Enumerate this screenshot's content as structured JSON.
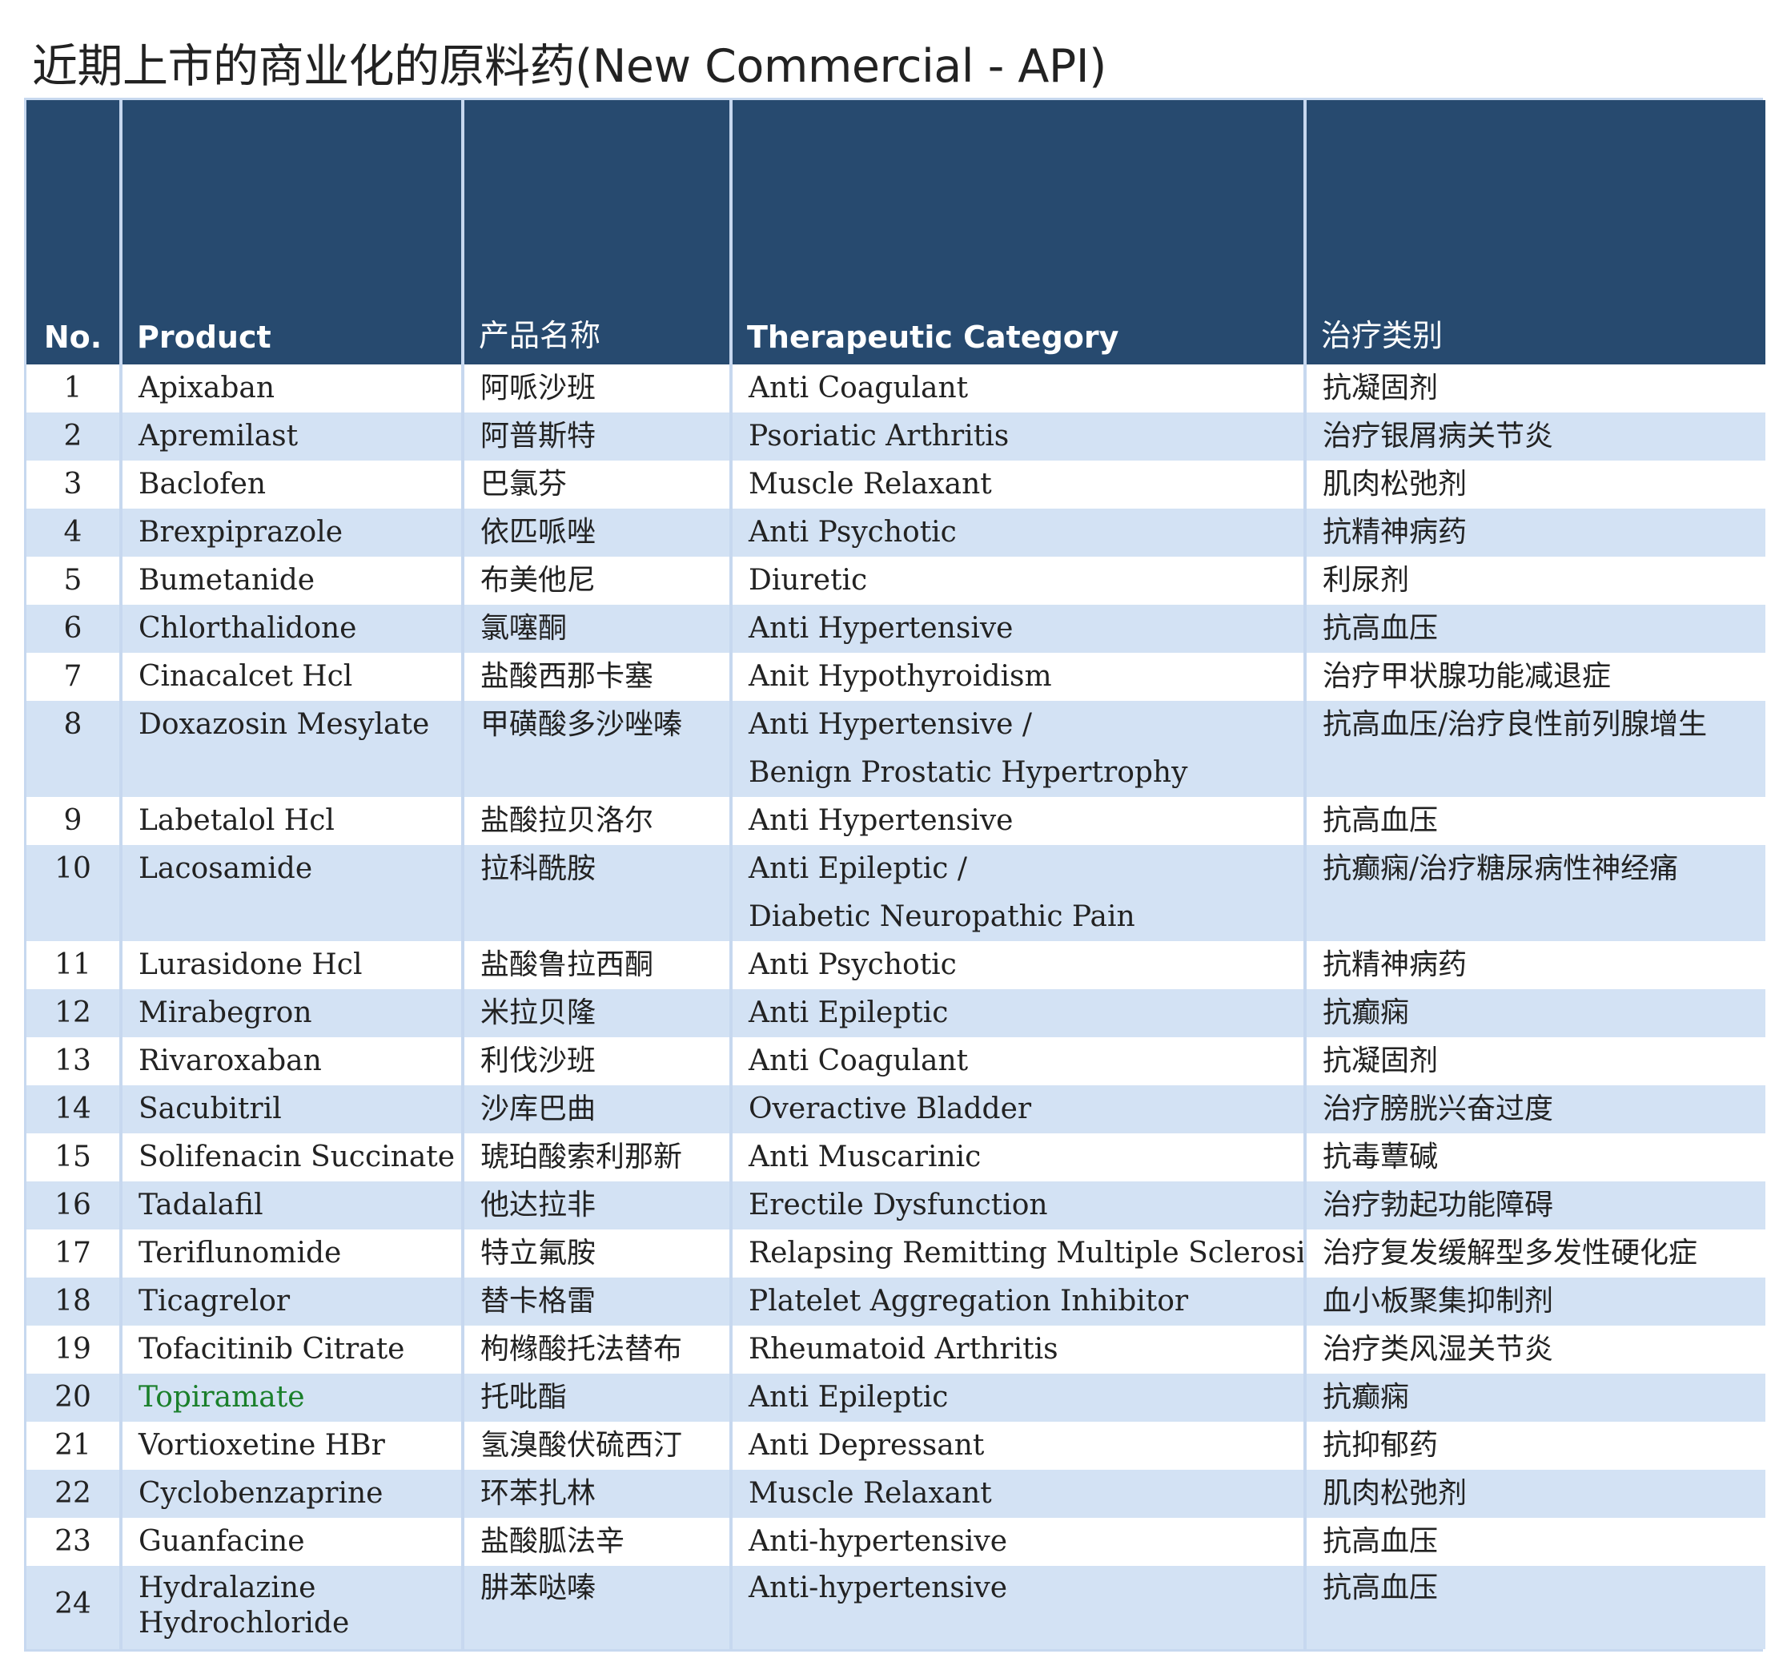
{
  "title": "近期上市的商业化的原料药(New Commercial - API)",
  "table": {
    "headers": {
      "no": "No.",
      "product": "Product",
      "product_cn": "产品名称",
      "category": "Therapeutic Category",
      "category_cn": "治疗类别"
    },
    "rows": [
      {
        "no": "1",
        "product": [
          "Apixaban"
        ],
        "product_cn": "阿哌沙班",
        "category": [
          "Anti Coagulant"
        ],
        "category_cn": "抗凝固剂"
      },
      {
        "no": "2",
        "product": [
          "Apremilast"
        ],
        "product_cn": "阿普斯特",
        "category": [
          "Psoriatic Arthritis"
        ],
        "category_cn": "治疗银屑病关节炎"
      },
      {
        "no": "3",
        "product": [
          "Baclofen"
        ],
        "product_cn": "巴氯芬",
        "category": [
          "Muscle Relaxant"
        ],
        "category_cn": "肌肉松弛剂"
      },
      {
        "no": "4",
        "product": [
          "Brexpiprazole"
        ],
        "product_cn": "依匹哌唑",
        "category": [
          "Anti Psychotic"
        ],
        "category_cn": "抗精神病药"
      },
      {
        "no": "5",
        "product": [
          "Bumetanide"
        ],
        "product_cn": "布美他尼",
        "category": [
          "Diuretic"
        ],
        "category_cn": "利尿剂"
      },
      {
        "no": "6",
        "product": [
          "Chlorthalidone"
        ],
        "product_cn": "氯噻酮",
        "category": [
          "Anti Hypertensive"
        ],
        "category_cn": "抗高血压"
      },
      {
        "no": "7",
        "product": [
          "Cinacalcet Hcl"
        ],
        "product_cn": "盐酸西那卡塞",
        "category": [
          "Anit Hypothyroidism"
        ],
        "category_cn": "治疗甲状腺功能减退症"
      },
      {
        "no": "8",
        "product": [
          "Doxazosin Mesylate"
        ],
        "product_cn": "甲磺酸多沙唑嗪",
        "category": [
          "Anti Hypertensive /",
          "Benign Prostatic Hypertrophy"
        ],
        "category_cn": "抗高血压/治疗良性前列腺增生"
      },
      {
        "no": "9",
        "product": [
          "Labetalol Hcl"
        ],
        "product_cn": "盐酸拉贝洛尔",
        "category": [
          "Anti Hypertensive"
        ],
        "category_cn": "抗高血压"
      },
      {
        "no": "10",
        "product": [
          "Lacosamide"
        ],
        "product_cn": "拉科酰胺",
        "category": [
          "Anti Epileptic /",
          "Diabetic Neuropathic Pain"
        ],
        "category_cn": "抗癫痫/治疗糖尿病性神经痛"
      },
      {
        "no": "11",
        "product": [
          "Lurasidone Hcl"
        ],
        "product_cn": "盐酸鲁拉西酮",
        "category": [
          "Anti Psychotic"
        ],
        "category_cn": "抗精神病药"
      },
      {
        "no": "12",
        "product": [
          "Mirabegron"
        ],
        "product_cn": "米拉贝隆",
        "category": [
          "Anti Epileptic"
        ],
        "category_cn": "抗癫痫"
      },
      {
        "no": "13",
        "product": [
          "Rivaroxaban"
        ],
        "product_cn": "利伐沙班",
        "category": [
          "Anti Coagulant"
        ],
        "category_cn": "抗凝固剂"
      },
      {
        "no": "14",
        "product": [
          "Sacubitril"
        ],
        "product_cn": "沙库巴曲",
        "category": [
          "Overactive Bladder"
        ],
        "category_cn": "治疗膀胱兴奋过度"
      },
      {
        "no": "15",
        "product": [
          "Solifenacin Succinate"
        ],
        "product_cn": "琥珀酸索利那新",
        "category": [
          "Anti Muscarinic"
        ],
        "category_cn": "抗毒蕈碱"
      },
      {
        "no": "16",
        "product": [
          "Tadalafil"
        ],
        "product_cn": "他达拉非",
        "category": [
          "Erectile Dysfunction"
        ],
        "category_cn": "治疗勃起功能障碍"
      },
      {
        "no": "17",
        "product": [
          "Teriflunomide"
        ],
        "product_cn": "特立氟胺",
        "category": [
          "Relapsing Remitting Multiple Sclerosis"
        ],
        "category_cn": "治疗复发缓解型多发性硬化症"
      },
      {
        "no": "18",
        "product": [
          "Ticagrelor"
        ],
        "product_cn": "替卡格雷",
        "category": [
          "Platelet Aggregation Inhibitor"
        ],
        "category_cn": "血小板聚集抑制剂"
      },
      {
        "no": "19",
        "product": [
          "Tofacitinib Citrate"
        ],
        "product_cn": "枸橼酸托法替布",
        "category": [
          "Rheumatoid Arthritis"
        ],
        "category_cn": "治疗类风湿关节炎"
      },
      {
        "no": "20",
        "product": [
          "Topiramate"
        ],
        "product_cn": "托吡酯",
        "category": [
          "Anti Epileptic"
        ],
        "category_cn": "抗癫痫",
        "highlight": true
      },
      {
        "no": "21",
        "product": [
          "Vortioxetine HBr"
        ],
        "product_cn": "氢溴酸伏硫西汀",
        "category": [
          "Anti Depressant"
        ],
        "category_cn": "抗抑郁药"
      },
      {
        "no": "22",
        "product": [
          "Cyclobenzaprine"
        ],
        "product_cn": "环苯扎林",
        "category": [
          "Muscle Relaxant"
        ],
        "category_cn": "肌肉松弛剂"
      },
      {
        "no": "23",
        "product": [
          "Guanfacine"
        ],
        "product_cn": "盐酸胍法辛",
        "category": [
          "Anti-hypertensive"
        ],
        "category_cn": "抗高血压"
      },
      {
        "no": "24",
        "product": [
          "Hydralazine",
          "Hydrochloride"
        ],
        "product_cn": "肼苯哒嗪",
        "category": [
          "Anti-hypertensive"
        ],
        "category_cn": "抗高血压"
      }
    ],
    "highlight_color": "#1a7f2a",
    "header_color": "#274a6f",
    "stripe_color": "#d3e2f4"
  }
}
